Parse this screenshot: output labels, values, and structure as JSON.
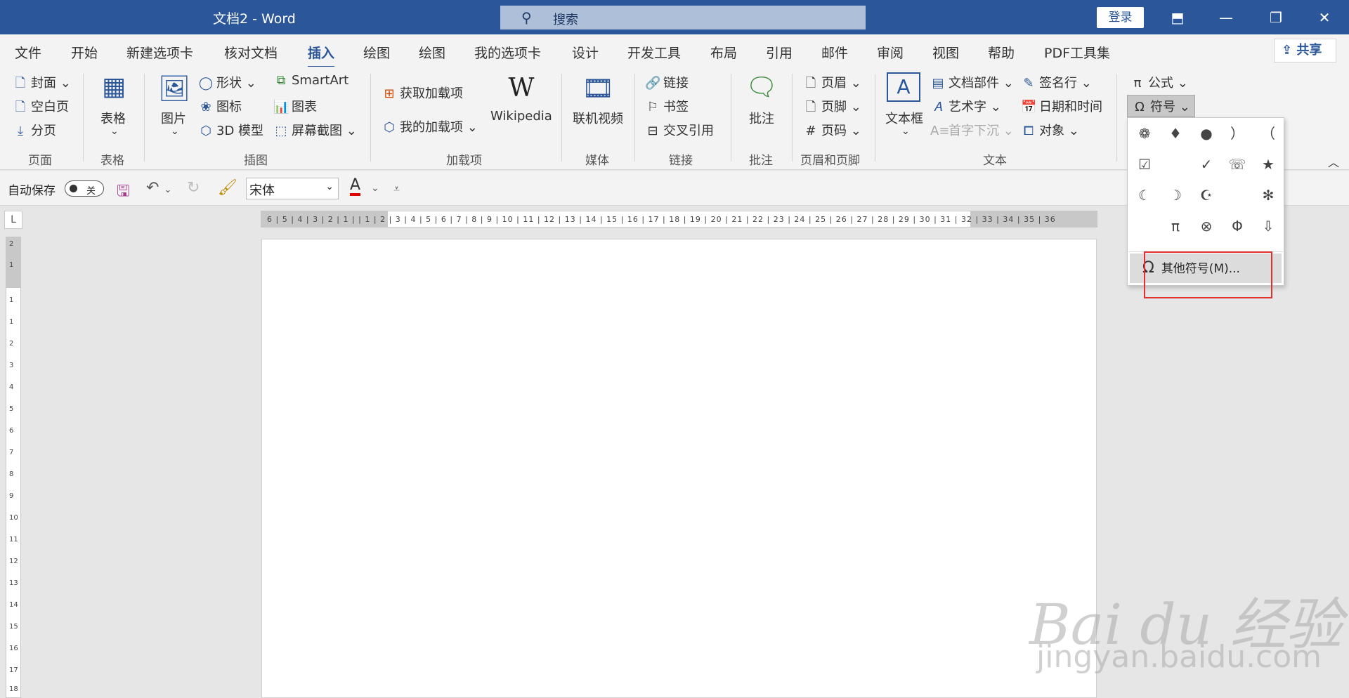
{
  "window": {
    "title": "文档2  -  Word",
    "search_placeholder": "搜索",
    "login": "登录",
    "share": "共享",
    "min_icon": "minimize-icon",
    "restore_icon": "restore-icon",
    "close_icon": "close-icon"
  },
  "tabs": [
    "文件",
    "开始",
    "新建选项卡",
    "核对文档",
    "插入",
    "绘图",
    "绘图",
    "我的选项卡",
    "设计",
    "开发工具",
    "布局",
    "引用",
    "邮件",
    "审阅",
    "视图",
    "帮助",
    "PDF工具集"
  ],
  "active_tab": "插入",
  "ribbon": {
    "pages": {
      "cover": "封面",
      "blank": "空白页",
      "break": "分页",
      "label": "页面"
    },
    "tables": {
      "table": "表格",
      "label": "表格"
    },
    "illustrations": {
      "pictures": "图片",
      "shapes": "形状",
      "icons": "图标",
      "model3d": "3D 模型",
      "smartart": "SmartArt",
      "chart": "图表",
      "screenshot": "屏幕截图",
      "label": "插图"
    },
    "addins": {
      "get": "获取加载项",
      "mine": "我的加载项",
      "wikipedia": "Wikipedia",
      "wiki_glyph": "W",
      "label": "加载项"
    },
    "media": {
      "video": "联机视频",
      "label": "媒体"
    },
    "links": {
      "link": "链接",
      "bookmark": "书签",
      "crossref": "交叉引用",
      "label": "链接"
    },
    "comments": {
      "comment": "批注",
      "label": "批注"
    },
    "header_footer": {
      "header": "页眉",
      "footer": "页脚",
      "page_number": "页码",
      "label": "页眉和页脚"
    },
    "text": {
      "textbox": "文本框",
      "textbox_glyph": "A",
      "quickparts": "文档部件",
      "wordart": "艺术字",
      "dropcap": "首字下沉",
      "signature": "签名行",
      "datetime": "日期和时间",
      "object": "对象",
      "label": "文本"
    },
    "symbols": {
      "equation": "公式",
      "symbol": "符号"
    }
  },
  "qat": {
    "autosave": "自动保存",
    "toggle_state": "关",
    "font": "宋体",
    "font_color_glyph": "A",
    "font_color": "#e00000"
  },
  "symbols_menu": {
    "grid": [
      "❁",
      "♦",
      "●",
      "）",
      "（",
      "☑",
      "",
      "✓",
      "☏",
      "★",
      "☾",
      "☽",
      "☪",
      "",
      "✻",
      "",
      "π",
      "⊗",
      "Φ",
      "⇩"
    ],
    "more": "其他符号(M)...",
    "omega_glyph": "Ω"
  },
  "ruler": {
    "marks": "6 | 5 | 4 | 3 | 2 | 1 |   | 1 | 2 | 3 | 4 | 5 | 6 | 7 | 8 | 9 | 10 | 11 | 12 | 13 | 14 | 15 | 16 | 17 | 18 | 19 | 20 | 21 | 22 | 23 | 24 | 25 | 26 | 27 | 28 | 29 | 30 | 31 | 32 | 33 | 34 | 35 | 36",
    "corner": "L",
    "vertical": [
      "2",
      "1",
      "1",
      "1",
      "2",
      "3",
      "4",
      "5",
      "6",
      "7",
      "8",
      "9",
      "10",
      "11",
      "12",
      "13",
      "14",
      "15",
      "16",
      "17",
      "18"
    ]
  },
  "watermark": {
    "brand": "Bai du 经验",
    "url": "jingyan.baidu.com"
  },
  "colors": {
    "brand": "#2b579a",
    "highlight": "#e03030"
  }
}
